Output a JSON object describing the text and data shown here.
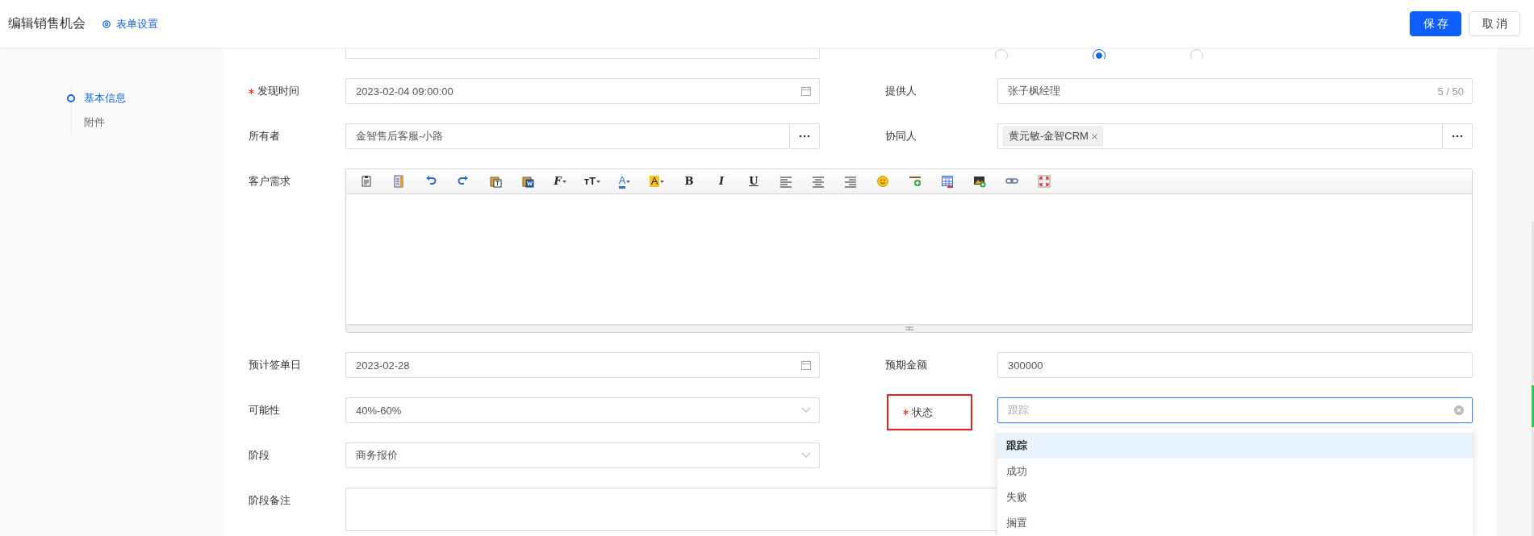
{
  "header": {
    "title": "编辑销售机会",
    "settings_link": "表单设置",
    "buttons": [
      {
        "label": "保存",
        "kind": "primary"
      },
      {
        "label": "取消",
        "kind": "default"
      }
    ]
  },
  "nav": [
    {
      "label": "基本信息",
      "selected": true
    },
    {
      "label": "附件",
      "selected": false
    }
  ],
  "partial_row": {
    "radios": [
      {
        "selected": false
      },
      {
        "selected": true
      },
      {
        "selected": false
      }
    ]
  },
  "form": {
    "rows": [
      {
        "fields": [
          {
            "label": "发现时间",
            "required": true,
            "focused": false,
            "annotated": false,
            "kind": "date",
            "value": "2023-02-04 09:00:00"
          },
          {
            "label": "提供人",
            "required": false,
            "focused": false,
            "annotated": false,
            "kind": "text",
            "value": "张子枫经理",
            "count": "5 / 50"
          }
        ]
      },
      {
        "fields": [
          {
            "label": "所有者",
            "required": false,
            "focused": false,
            "annotated": false,
            "kind": "picker",
            "value": "金智售后客服-小路"
          },
          {
            "label": "协同人",
            "required": false,
            "focused": false,
            "annotated": false,
            "kind": "tags",
            "tags": [
              "黄元敏-金智CRM"
            ]
          }
        ]
      },
      {
        "fields": [
          {
            "label": "客户需求",
            "required": false,
            "focused": false,
            "annotated": false,
            "kind": "editor",
            "toolbar": [
              {
                "kind": "paste"
              },
              {
                "kind": "template"
              },
              {
                "kind": "undo"
              },
              {
                "kind": "redo"
              },
              {
                "kind": "paste-text"
              },
              {
                "kind": "paste-word"
              },
              {
                "kind": "font",
                "label": "F"
              },
              {
                "kind": "size",
                "label": "ᴛT"
              },
              {
                "kind": "forecolor",
                "label": "A"
              },
              {
                "kind": "backcolor",
                "label": "A"
              },
              {
                "kind": "bold",
                "label": "B"
              },
              {
                "kind": "italic",
                "label": "I"
              },
              {
                "kind": "underline",
                "label": "U"
              },
              {
                "kind": "align-left"
              },
              {
                "kind": "align-center"
              },
              {
                "kind": "align-right"
              },
              {
                "kind": "emoji"
              },
              {
                "kind": "hr"
              },
              {
                "kind": "table"
              },
              {
                "kind": "image"
              },
              {
                "kind": "link"
              },
              {
                "kind": "fullscreen"
              }
            ]
          }
        ]
      },
      {
        "fields": [
          {
            "label": "预计签单日",
            "required": false,
            "focused": false,
            "annotated": false,
            "kind": "date",
            "value": "2023-02-28"
          },
          {
            "label": "预期金额",
            "required": false,
            "focused": false,
            "annotated": false,
            "kind": "text",
            "value": "300000"
          }
        ]
      },
      {
        "fields": [
          {
            "label": "可能性",
            "required": false,
            "focused": false,
            "annotated": false,
            "kind": "select",
            "value": "40%-60%"
          },
          {
            "label": "状态",
            "required": true,
            "focused": true,
            "annotated": true,
            "kind": "select",
            "placeholder": "跟踪",
            "options": [
              {
                "label": "跟踪",
                "selected": true
              },
              {
                "label": "成功",
                "selected": false
              },
              {
                "label": "失败",
                "selected": false
              },
              {
                "label": "搁置",
                "selected": false
              }
            ]
          }
        ]
      },
      {
        "fields": [
          {
            "label": "阶段",
            "required": false,
            "focused": false,
            "annotated": false,
            "kind": "select",
            "value": "商务报价"
          }
        ]
      },
      {
        "fields": [
          {
            "label": "阶段备注",
            "required": false,
            "focused": false,
            "annotated": false,
            "kind": "textarea"
          }
        ]
      }
    ]
  }
}
